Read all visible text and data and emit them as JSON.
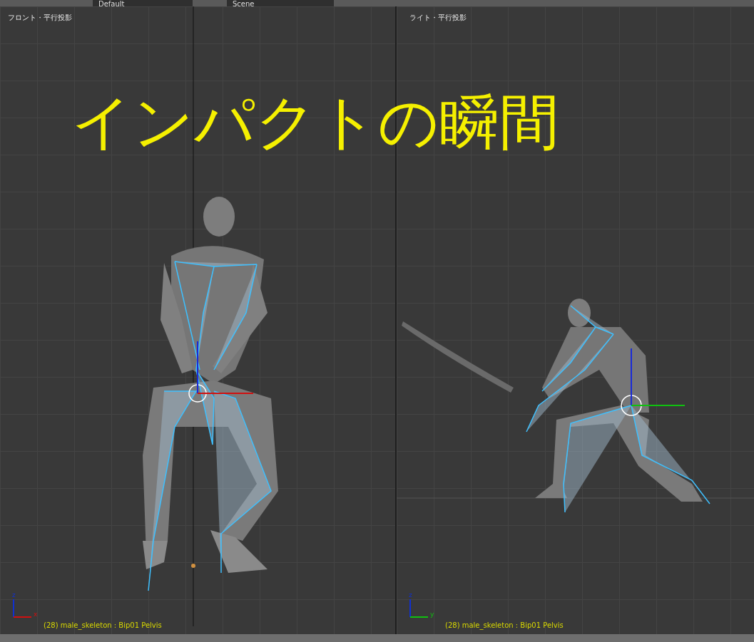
{
  "top_bar": {
    "layout": "Default",
    "scene": "Scene"
  },
  "overlay_title": "インパクトの瞬間",
  "viewports": [
    {
      "title": "フロント・平行投影",
      "kind": "front",
      "status": "(28) male_skeleton : Bip01 Pelvis",
      "axes": [
        "z",
        "x"
      ]
    },
    {
      "title": "ライト・平行投影",
      "kind": "right",
      "status": "(28) male_skeleton : Bip01 Pelvis",
      "axes": [
        "z",
        "y"
      ]
    }
  ]
}
